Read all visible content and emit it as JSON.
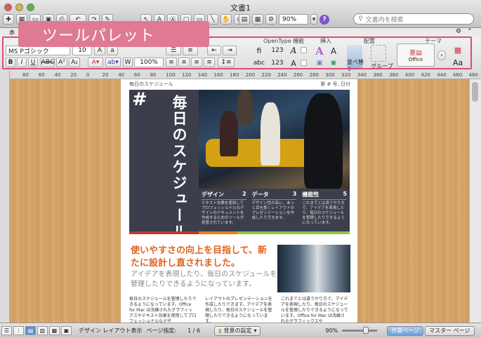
{
  "window": {
    "title": "文書1"
  },
  "toolbar": {
    "zoom": "90%",
    "help": "?",
    "search_placeholder": "文書内を検索"
  },
  "callout": {
    "text": "ツールパレット"
  },
  "ribbon": {
    "tab_home": "ホ",
    "font_name": "MS Pゴシック",
    "font_size": "10",
    "zoom_percent": "100%",
    "groups": {
      "opentype": "OpenType 機能",
      "insert": "挿入",
      "arrange": "配置",
      "theme": "テーマ"
    },
    "fi": "fi",
    "num": "123",
    "abc": "abc",
    "reorder": "並べ替え",
    "group": "グループ",
    "office": "Office",
    "aa": "Aa"
  },
  "ruler": {
    "ticks": [
      "80",
      "60",
      "40",
      "20",
      "0",
      "20",
      "40",
      "60",
      "80",
      "100",
      "120",
      "140",
      "160",
      "180",
      "200",
      "220",
      "240",
      "260",
      "280",
      "300",
      "320",
      "340",
      "360",
      "380",
      "400",
      "420",
      "440",
      "460",
      "480"
    ]
  },
  "doc": {
    "header_left": "毎日のスケジュール",
    "header_right": "第 # 号, 日付",
    "hash": "#",
    "vertical_title": "毎日のスケジュール",
    "columns": [
      {
        "title": "デザイン",
        "num": "2",
        "text": "テキスト効果を使用してプロフェッショナルなデザインのドキュメントを作成するためのツールが用意されています。"
      },
      {
        "title": "データ",
        "num": "3",
        "text": "デザイン性の高い、あっと目を惹くレイアウトのプレゼンテーションを作成したりできます。"
      },
      {
        "title": "機能性",
        "num": "5",
        "text": "これまでとは違うやり方で、アイデアを表現したり、毎日のスケジュールを管理したりできるようになっています。"
      }
    ],
    "headline": "使いやすさの向上を目指して、新たに設計し直されました。",
    "subhead": "アイデアを表現したり、毎日のスケジュールを管理したりできるようになっています。",
    "body1": "毎日のスケジュールを管理したりできるようになっています。Office for Mac は洗練されたグラフィックスやテキスト効果を使用してプロフェッショナルなデザ",
    "body2": "レイアウトのプレゼンテーションを作成したりできます。アイデアを表現したり、毎日のスケジュールを管理したりできるようになっています。",
    "body3": "これまでとは違うやり方で、アイデアを表現したり、毎日のスケジュールを管理したりできるようになっています。Office for Mac は洗練されたグラフィックスや"
  },
  "status": {
    "layout_mode": "デザイン レイアウト表示",
    "page_label": "ページ指定:",
    "page_value": "1 / 6",
    "background": "背景の設定",
    "zoom": "90%",
    "work_page": "作業ページ",
    "master_page": "マスター ページ"
  },
  "colors": {
    "accent": "#d94d78",
    "headline": "#e06424",
    "panel": "#3c3e4b"
  }
}
